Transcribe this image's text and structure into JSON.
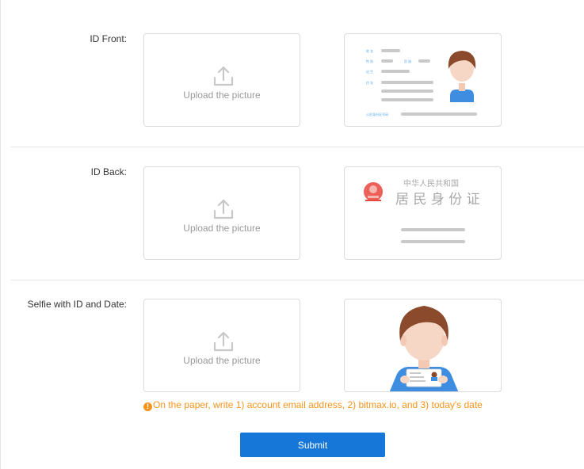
{
  "rows": [
    {
      "label": "ID Front:",
      "upload_text": "Upload the picture"
    },
    {
      "label": "ID Back:",
      "upload_text": "Upload the picture"
    },
    {
      "label": "Selfie with ID and Date:",
      "upload_text": "Upload the picture"
    }
  ],
  "sample_front": {
    "field_labels": [
      "姓 名",
      "性 别",
      "民 族",
      "出 生",
      "住 址"
    ],
    "id_number_label": "公民身份证号码"
  },
  "sample_back": {
    "country": "中华人民共和国",
    "title": "居 民 身 份 证"
  },
  "hint": {
    "icon": "warning-icon",
    "text": "On the paper, write 1) account email address, 2) bitmax.io, and 3) today's date"
  },
  "submit_label": "Submit",
  "colors": {
    "accent": "#1677d9",
    "warning": "#f7941d",
    "emblem": "#e8453c"
  }
}
